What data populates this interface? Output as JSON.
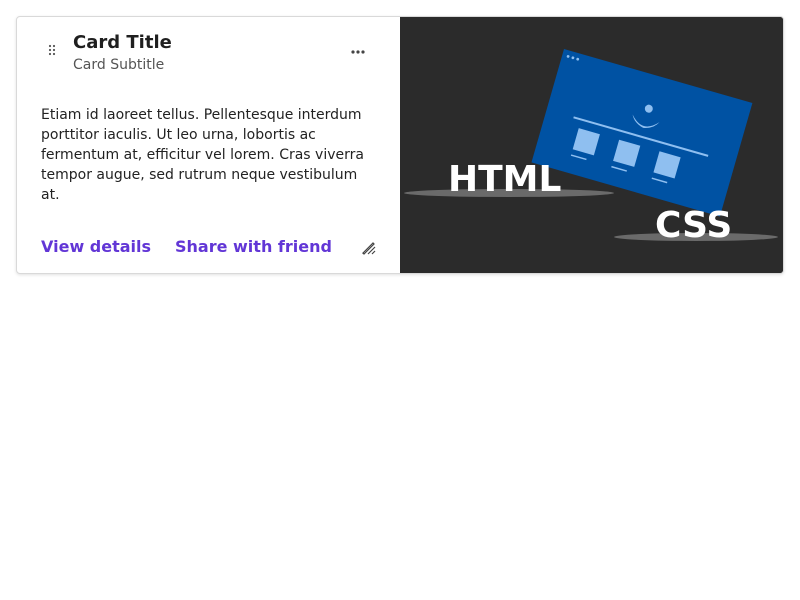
{
  "card": {
    "title": "Card Title",
    "subtitle": "Card Subtitle",
    "body": "Etiam id laoreet tellus. Pellentesque interdum porttitor iaculis. Ut leo urna, lobortis ac fermentum at, efficitur vel lorem. Cras viverra tempor augue, sed rutrum neque vestibulum at.",
    "actions": {
      "primary_label": "View details",
      "secondary_label": "Share with friend"
    },
    "icons": {
      "drag": "drag-handle-icon",
      "more": "more-horizontal-icon",
      "edit": "edit-pencil-icon"
    },
    "media": {
      "label_html": "HTML",
      "label_css": "CSS"
    }
  },
  "colors": {
    "accent": "#6236d6",
    "media_background": "#2b2b2b",
    "window_blue": "#0052a3",
    "window_light": "#8fbff0"
  }
}
